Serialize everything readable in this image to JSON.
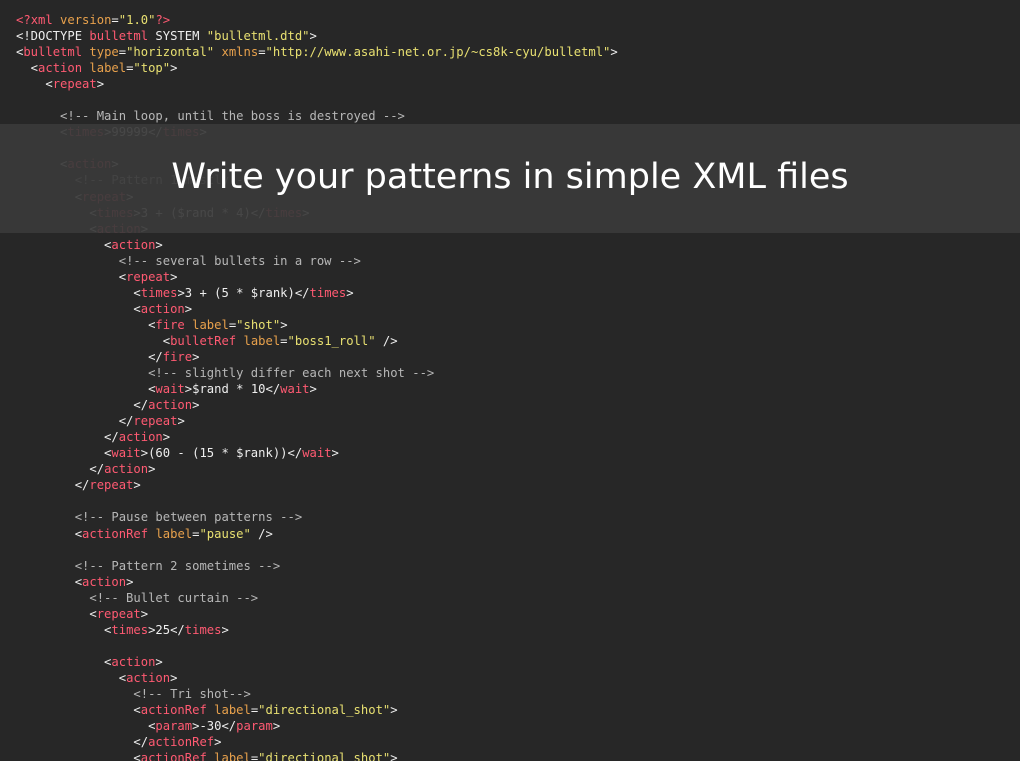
{
  "banner": {
    "title": "Write your patterns in simple XML files"
  },
  "colors": {
    "background": "#272727",
    "banner": "#3a3a3a",
    "tag": "#ff5a72",
    "attribute": "#e8a14c",
    "string": "#e8e071",
    "comment": "#b7b7b7",
    "text": "#eeeeee"
  },
  "code_lines": [
    [
      [
        "tag",
        "<?"
      ],
      [
        "tag",
        "xml"
      ],
      [
        "txt",
        " "
      ],
      [
        "attr",
        "version"
      ],
      [
        "txt",
        "="
      ],
      [
        "str",
        "\"1.0\""
      ],
      [
        "tag",
        "?>"
      ]
    ],
    [
      [
        "txt",
        "<!DOCTYPE "
      ],
      [
        "tag",
        "bulletml"
      ],
      [
        "txt",
        " SYSTEM "
      ],
      [
        "str",
        "\"bulletml.dtd\""
      ],
      [
        "txt",
        ">"
      ]
    ],
    [
      [
        "txt",
        "<"
      ],
      [
        "tag",
        "bulletml"
      ],
      [
        "txt",
        " "
      ],
      [
        "attr",
        "type"
      ],
      [
        "txt",
        "="
      ],
      [
        "str",
        "\"horizontal\""
      ],
      [
        "txt",
        " "
      ],
      [
        "attr",
        "xmlns"
      ],
      [
        "txt",
        "="
      ],
      [
        "str",
        "\"http://www.asahi-net.or.jp/~cs8k-cyu/bulletml\""
      ],
      [
        "txt",
        ">"
      ]
    ],
    [
      [
        "txt",
        "  <"
      ],
      [
        "tag",
        "action"
      ],
      [
        "txt",
        " "
      ],
      [
        "attr",
        "label"
      ],
      [
        "txt",
        "="
      ],
      [
        "str",
        "\"top\""
      ],
      [
        "txt",
        ">"
      ]
    ],
    [
      [
        "txt",
        "    <"
      ],
      [
        "tag",
        "repeat"
      ],
      [
        "txt",
        ">"
      ]
    ],
    [
      [
        "txt",
        ""
      ]
    ],
    [
      [
        "txt",
        "      "
      ],
      [
        "com",
        "<!-- Main loop, until the boss is destroyed -->"
      ]
    ],
    [
      [
        "txt",
        "      <"
      ],
      [
        "tag",
        "times"
      ],
      [
        "txt",
        ">99999</"
      ],
      [
        "tag",
        "times"
      ],
      [
        "txt",
        ">"
      ]
    ],
    [
      [
        "txt",
        ""
      ]
    ],
    [
      [
        "txt",
        "      <"
      ],
      [
        "tag",
        "action"
      ],
      [
        "txt",
        ">"
      ]
    ],
    [
      [
        "txt",
        "        "
      ],
      [
        "com",
        "<!-- Pattern 1 mostly -->"
      ]
    ],
    [
      [
        "txt",
        "        <"
      ],
      [
        "tag",
        "repeat"
      ],
      [
        "txt",
        ">"
      ]
    ],
    [
      [
        "txt",
        "          <"
      ],
      [
        "tag",
        "times"
      ],
      [
        "txt",
        ">3 + ($rand * 4)</"
      ],
      [
        "tag",
        "times"
      ],
      [
        "txt",
        ">"
      ]
    ],
    [
      [
        "txt",
        "          <"
      ],
      [
        "tag",
        "action"
      ],
      [
        "txt",
        ">"
      ]
    ],
    [
      [
        "txt",
        "            <"
      ],
      [
        "tag",
        "action"
      ],
      [
        "txt",
        ">"
      ]
    ],
    [
      [
        "txt",
        "              "
      ],
      [
        "com",
        "<!-- several bullets in a row -->"
      ]
    ],
    [
      [
        "txt",
        "              <"
      ],
      [
        "tag",
        "repeat"
      ],
      [
        "txt",
        ">"
      ]
    ],
    [
      [
        "txt",
        "                <"
      ],
      [
        "tag",
        "times"
      ],
      [
        "txt",
        ">3 + (5 * $rank)</"
      ],
      [
        "tag",
        "times"
      ],
      [
        "txt",
        ">"
      ]
    ],
    [
      [
        "txt",
        "                <"
      ],
      [
        "tag",
        "action"
      ],
      [
        "txt",
        ">"
      ]
    ],
    [
      [
        "txt",
        "                  <"
      ],
      [
        "tag",
        "fire"
      ],
      [
        "txt",
        " "
      ],
      [
        "attr",
        "label"
      ],
      [
        "txt",
        "="
      ],
      [
        "str",
        "\"shot\""
      ],
      [
        "txt",
        ">"
      ]
    ],
    [
      [
        "txt",
        "                    <"
      ],
      [
        "tag",
        "bulletRef"
      ],
      [
        "txt",
        " "
      ],
      [
        "attr",
        "label"
      ],
      [
        "txt",
        "="
      ],
      [
        "str",
        "\"boss1_roll\""
      ],
      [
        "txt",
        " />"
      ]
    ],
    [
      [
        "txt",
        "                  </"
      ],
      [
        "tag",
        "fire"
      ],
      [
        "txt",
        ">"
      ]
    ],
    [
      [
        "txt",
        "                  "
      ],
      [
        "com",
        "<!-- slightly differ each next shot -->"
      ]
    ],
    [
      [
        "txt",
        "                  <"
      ],
      [
        "tag",
        "wait"
      ],
      [
        "txt",
        ">$rand * 10</"
      ],
      [
        "tag",
        "wait"
      ],
      [
        "txt",
        ">"
      ]
    ],
    [
      [
        "txt",
        "                </"
      ],
      [
        "tag",
        "action"
      ],
      [
        "txt",
        ">"
      ]
    ],
    [
      [
        "txt",
        "              </"
      ],
      [
        "tag",
        "repeat"
      ],
      [
        "txt",
        ">"
      ]
    ],
    [
      [
        "txt",
        "            </"
      ],
      [
        "tag",
        "action"
      ],
      [
        "txt",
        ">"
      ]
    ],
    [
      [
        "txt",
        "            <"
      ],
      [
        "tag",
        "wait"
      ],
      [
        "txt",
        ">(60 - (15 * $rank))</"
      ],
      [
        "tag",
        "wait"
      ],
      [
        "txt",
        ">"
      ]
    ],
    [
      [
        "txt",
        "          </"
      ],
      [
        "tag",
        "action"
      ],
      [
        "txt",
        ">"
      ]
    ],
    [
      [
        "txt",
        "        </"
      ],
      [
        "tag",
        "repeat"
      ],
      [
        "txt",
        ">"
      ]
    ],
    [
      [
        "txt",
        ""
      ]
    ],
    [
      [
        "txt",
        "        "
      ],
      [
        "com",
        "<!-- Pause between patterns -->"
      ]
    ],
    [
      [
        "txt",
        "        <"
      ],
      [
        "tag",
        "actionRef"
      ],
      [
        "txt",
        " "
      ],
      [
        "attr",
        "label"
      ],
      [
        "txt",
        "="
      ],
      [
        "str",
        "\"pause\""
      ],
      [
        "txt",
        " />"
      ]
    ],
    [
      [
        "txt",
        ""
      ]
    ],
    [
      [
        "txt",
        "        "
      ],
      [
        "com",
        "<!-- Pattern 2 sometimes -->"
      ]
    ],
    [
      [
        "txt",
        "        <"
      ],
      [
        "tag",
        "action"
      ],
      [
        "txt",
        ">"
      ]
    ],
    [
      [
        "txt",
        "          "
      ],
      [
        "com",
        "<!-- Bullet curtain -->"
      ]
    ],
    [
      [
        "txt",
        "          <"
      ],
      [
        "tag",
        "repeat"
      ],
      [
        "txt",
        ">"
      ]
    ],
    [
      [
        "txt",
        "            <"
      ],
      [
        "tag",
        "times"
      ],
      [
        "txt",
        ">25</"
      ],
      [
        "tag",
        "times"
      ],
      [
        "txt",
        ">"
      ]
    ],
    [
      [
        "txt",
        ""
      ]
    ],
    [
      [
        "txt",
        "            <"
      ],
      [
        "tag",
        "action"
      ],
      [
        "txt",
        ">"
      ]
    ],
    [
      [
        "txt",
        "              <"
      ],
      [
        "tag",
        "action"
      ],
      [
        "txt",
        ">"
      ]
    ],
    [
      [
        "txt",
        "                "
      ],
      [
        "com",
        "<!-- Tri shot-->"
      ]
    ],
    [
      [
        "txt",
        "                <"
      ],
      [
        "tag",
        "actionRef"
      ],
      [
        "txt",
        " "
      ],
      [
        "attr",
        "label"
      ],
      [
        "txt",
        "="
      ],
      [
        "str",
        "\"directional_shot\""
      ],
      [
        "txt",
        ">"
      ]
    ],
    [
      [
        "txt",
        "                  <"
      ],
      [
        "tag",
        "param"
      ],
      [
        "txt",
        ">-30</"
      ],
      [
        "tag",
        "param"
      ],
      [
        "txt",
        ">"
      ]
    ],
    [
      [
        "txt",
        "                </"
      ],
      [
        "tag",
        "actionRef"
      ],
      [
        "txt",
        ">"
      ]
    ],
    [
      [
        "txt",
        "                <"
      ],
      [
        "tag",
        "actionRef"
      ],
      [
        "txt",
        " "
      ],
      [
        "attr",
        "label"
      ],
      [
        "txt",
        "="
      ],
      [
        "str",
        "\"directional_shot\""
      ],
      [
        "txt",
        ">"
      ]
    ]
  ]
}
